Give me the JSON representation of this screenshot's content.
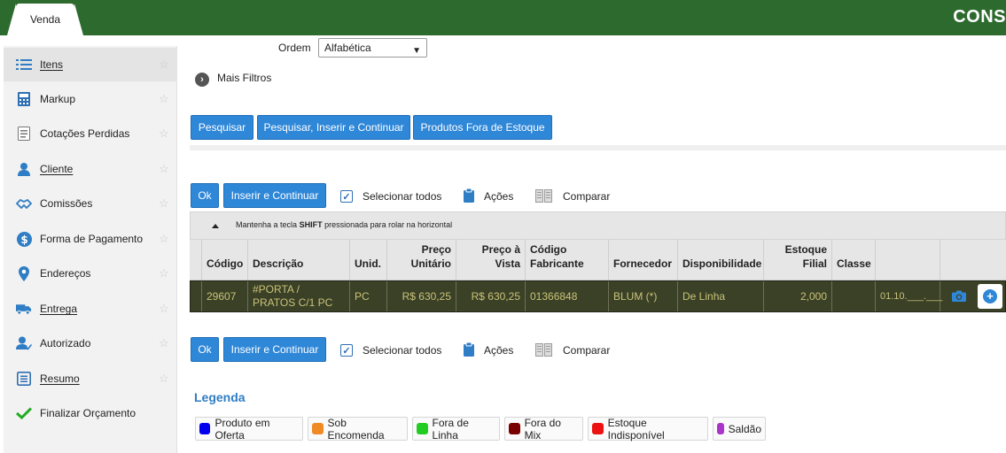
{
  "top_tab": "Venda",
  "brand_text": "CONS",
  "sidebar": {
    "items": [
      {
        "label": "Itens",
        "icon": "list-icon",
        "active": true
      },
      {
        "label": "Markup",
        "icon": "calculator-icon"
      },
      {
        "label": "Cotações Perdidas",
        "icon": "document-list-icon"
      },
      {
        "label": "Cliente",
        "icon": "user-icon"
      },
      {
        "label": "Comissões",
        "icon": "handshake-icon"
      },
      {
        "label": "Forma de Pagamento",
        "icon": "dollar-icon"
      },
      {
        "label": "Endereços",
        "icon": "location-pin-icon"
      },
      {
        "label": "Entrega",
        "icon": "truck-icon"
      },
      {
        "label": "Autorizado",
        "icon": "user-check-icon"
      },
      {
        "label": "Resumo",
        "icon": "summary-icon"
      },
      {
        "label": "Finalizar Orçamento",
        "icon": "checkmark-icon"
      }
    ]
  },
  "filters": {
    "ordem_label": "Ordem",
    "ordem_value": "Alfabética",
    "mais_filtros": "Mais Filtros"
  },
  "search_buttons": {
    "pesquisar": "Pesquisar",
    "pesquisar_inserir": "Pesquisar, Inserir e Continuar",
    "fora_estoque": "Produtos Fora de Estoque"
  },
  "actions": {
    "ok": "Ok",
    "inserir_continuar": "Inserir e Continuar",
    "selecionar_todos": "Selecionar todos",
    "acoes": "Ações",
    "comparar": "Comparar"
  },
  "table": {
    "hint": "Mantenha a tecla ",
    "hint_key": "SHIFT",
    "hint_end": " pressionada para rolar na horizontal",
    "headers": {
      "codigo": "Código",
      "descricao": "Descrição",
      "unid": "Unid.",
      "preco_unitario": "Preço Unitário",
      "preco_vista": "Preço à Vista",
      "codigo_fabricante": "Código Fabricante",
      "fornecedor": "Fornecedor",
      "disponibilidade": "Disponibilidade",
      "estoque_filial": "Estoque Filial",
      "classe": "Classe"
    },
    "rows": [
      {
        "codigo": "29607",
        "descricao": "#PORTA / PRATOS C/1 PC",
        "unid": "PC",
        "preco_unitario": "R$ 630,25",
        "preco_vista": "R$ 630,25",
        "codigo_fabricante": "01366848",
        "fornecedor": "BLUM (*)",
        "disponibilidade": "De Linha",
        "estoque_filial": "2,000",
        "classe": "",
        "extra": "01.10.___.___"
      }
    ]
  },
  "legend": {
    "title": "Legenda",
    "items": [
      {
        "label": "Produto em Oferta",
        "color": "#0000ee"
      },
      {
        "label": "Sob Encomenda",
        "color": "#f08a24"
      },
      {
        "label": "Fora de Linha",
        "color": "#22cc22"
      },
      {
        "label": "Fora do Mix",
        "color": "#7a0000"
      },
      {
        "label": "Estoque Indisponível",
        "color": "#ee1111"
      },
      {
        "label": "Saldão",
        "color": "#aa33cc"
      }
    ]
  }
}
